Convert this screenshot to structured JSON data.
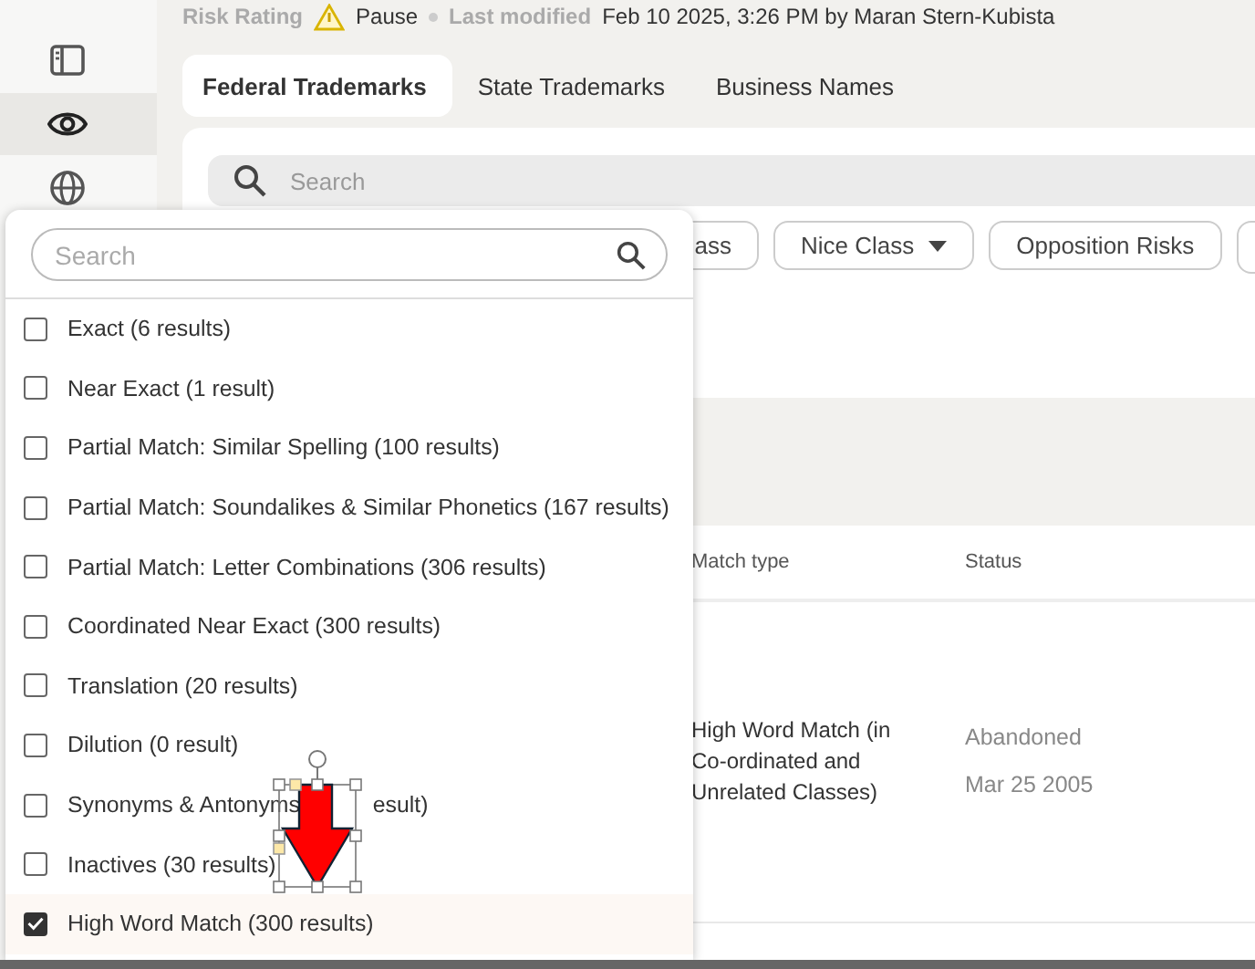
{
  "header": {
    "risk_label": "Risk Rating",
    "risk_value": "Pause",
    "modified_label": "Last modified",
    "modified_value": "Feb 10 2025, 3:26 PM by Maran Stern-Kubista"
  },
  "sidebar": {
    "items": [
      {
        "kind": "panel",
        "selected": false
      },
      {
        "kind": "eye",
        "selected": true
      },
      {
        "kind": "globe",
        "selected": false
      }
    ]
  },
  "tabs": [
    {
      "label": "Federal Trademarks",
      "selected": true
    },
    {
      "label": "State Trademarks",
      "selected": false
    },
    {
      "label": "Business Names",
      "selected": false
    }
  ],
  "search": {
    "placeholder": "Search"
  },
  "filters": [
    {
      "label": "ass",
      "dropdown": false
    },
    {
      "label": "Nice Class",
      "dropdown": true
    },
    {
      "label": "Opposition Risks",
      "dropdown": false
    }
  ],
  "filter_overflow": true,
  "table": {
    "columns": [
      "Match type",
      "Status"
    ],
    "rows": [
      {
        "match_type": "High Word Match (in Co-ordinated and Unrelated Classes)",
        "status": "Abandoned",
        "date": "Mar 25 2005"
      }
    ]
  },
  "dropdown": {
    "search_placeholder": "Search",
    "options": [
      {
        "label": "Exact (6 results)",
        "checked": false
      },
      {
        "label": "Near Exact (1 result)",
        "checked": false
      },
      {
        "label": "Partial Match: Similar Spelling (100 results)",
        "checked": false
      },
      {
        "label": "Partial Match: Soundalikes & Similar Phonetics (167 results)",
        "checked": false
      },
      {
        "label": "Partial Match: Letter Combinations (306 results)",
        "checked": false
      },
      {
        "label": "Coordinated Near Exact (300 results)",
        "checked": false
      },
      {
        "label": "Translation (20 results)",
        "checked": false
      },
      {
        "label": "Dilution (0 result)",
        "checked": false
      },
      {
        "label": "Synonyms & Antonyms",
        "label_tail": "esult)",
        "checked": false
      },
      {
        "label": "Inactives (30 results)",
        "checked": false
      },
      {
        "label": "High Word Match (300 results)",
        "checked": true
      }
    ]
  }
}
